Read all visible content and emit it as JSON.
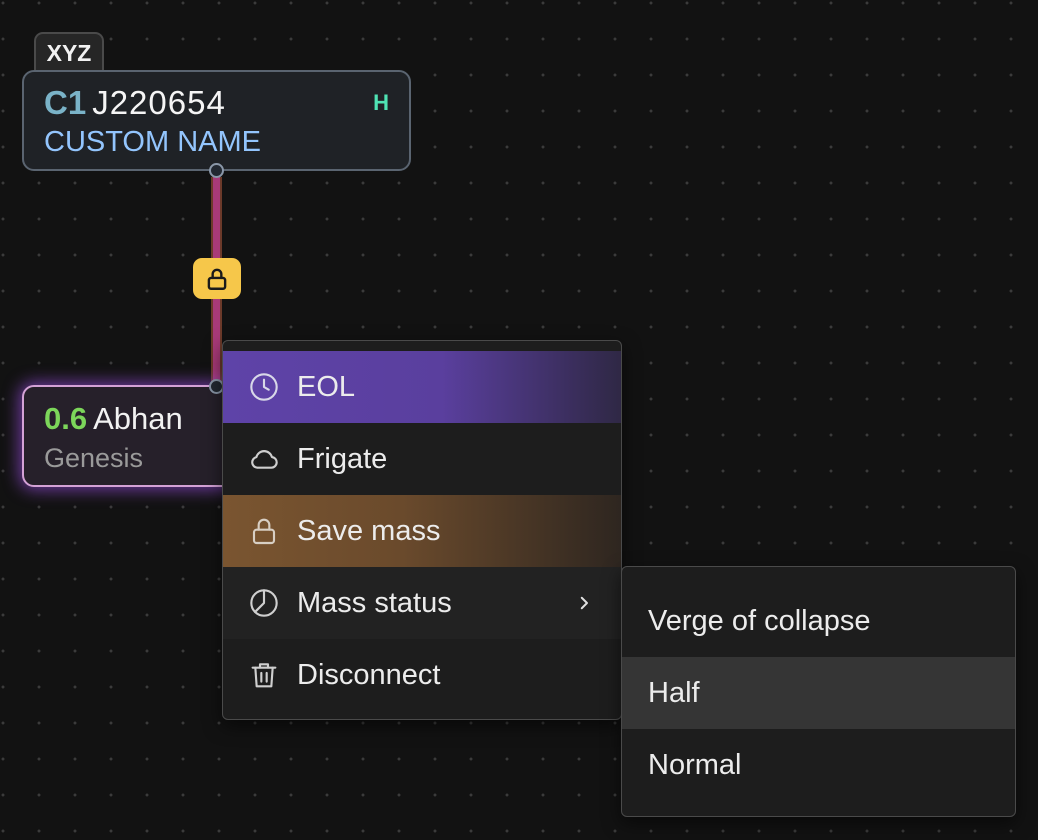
{
  "system_top": {
    "tag": "XYZ",
    "class_label": "C1",
    "name": "J220654",
    "effect": "H",
    "custom_name": "CUSTOM NAME"
  },
  "connection": {
    "lock_icon": "lock-icon",
    "line_color": "#a83a78",
    "badge_color": "#f6c74a"
  },
  "system_bottom": {
    "security": "0.6",
    "name": "Abhan",
    "region": "Genesis"
  },
  "context_menu": {
    "items": [
      {
        "label": "EOL",
        "icon": "clock-icon"
      },
      {
        "label": "Frigate",
        "icon": "cloud-icon"
      },
      {
        "label": "Save mass",
        "icon": "lock-icon"
      },
      {
        "label": "Mass status",
        "icon": "pie-chart-icon"
      },
      {
        "label": "Disconnect",
        "icon": "trash-icon"
      }
    ]
  },
  "submenu": {
    "items": [
      {
        "label": "Verge of collapse"
      },
      {
        "label": "Half"
      },
      {
        "label": "Normal"
      }
    ]
  },
  "colors": {
    "eol_highlight": "#5e43a8",
    "save_mass_highlight": "#7a5530",
    "security_high": "#7cd65a",
    "wormhole_class": "#7ab3c8",
    "effect": "#4fe3b4",
    "custom_name": "#93c5fd"
  }
}
